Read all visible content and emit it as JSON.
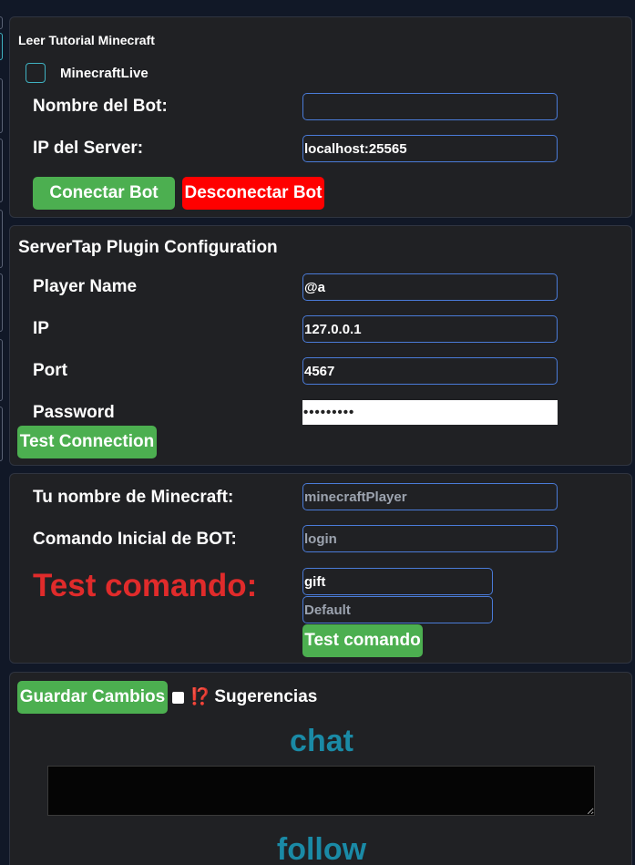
{
  "bot_panel": {
    "tutorial_link": "Leer Tutorial Minecraft",
    "minecraftlive_label": "MinecraftLive",
    "bot_name_label": "Nombre del Bot:",
    "bot_name_value": "",
    "server_ip_label": "IP del Server:",
    "server_ip_value": "localhost:25565",
    "connect_button": "Conectar Bot",
    "disconnect_button": "Desconectar Bot"
  },
  "servertap_panel": {
    "title": "ServerTap Plugin Configuration",
    "player_name_label": "Player Name",
    "player_name_value": "@a",
    "ip_label": "IP",
    "ip_value": "127.0.0.1",
    "port_label": "Port",
    "port_value": "4567",
    "password_label": "Password",
    "password_value": "•••••••••",
    "test_connection_button": "Test Connection"
  },
  "command_panel": {
    "minecraft_name_label": "Tu nombre de Minecraft:",
    "minecraft_name_placeholder": "minecraftPlayer",
    "initial_command_label": "Comando Inicial de BOT:",
    "initial_command_placeholder": "login",
    "test_command_heading": "Test comando:",
    "test_command_value": "gift",
    "test_command_default_placeholder": "Default",
    "test_command_button": "Test comando"
  },
  "actions_panel": {
    "save_button": "Guardar Cambios",
    "suggestions_icon": "⁉️",
    "suggestions_label": "Sugerencias",
    "chat_heading": "chat",
    "chat_value": "",
    "follow_heading": "follow"
  },
  "colors": {
    "background": "#111827",
    "panel": "#202124",
    "input_border": "#4a7bd8",
    "green": "#4caf50",
    "red": "#ff0000",
    "red_heading": "#e02b2b",
    "teal_heading": "#1a8aa6"
  }
}
